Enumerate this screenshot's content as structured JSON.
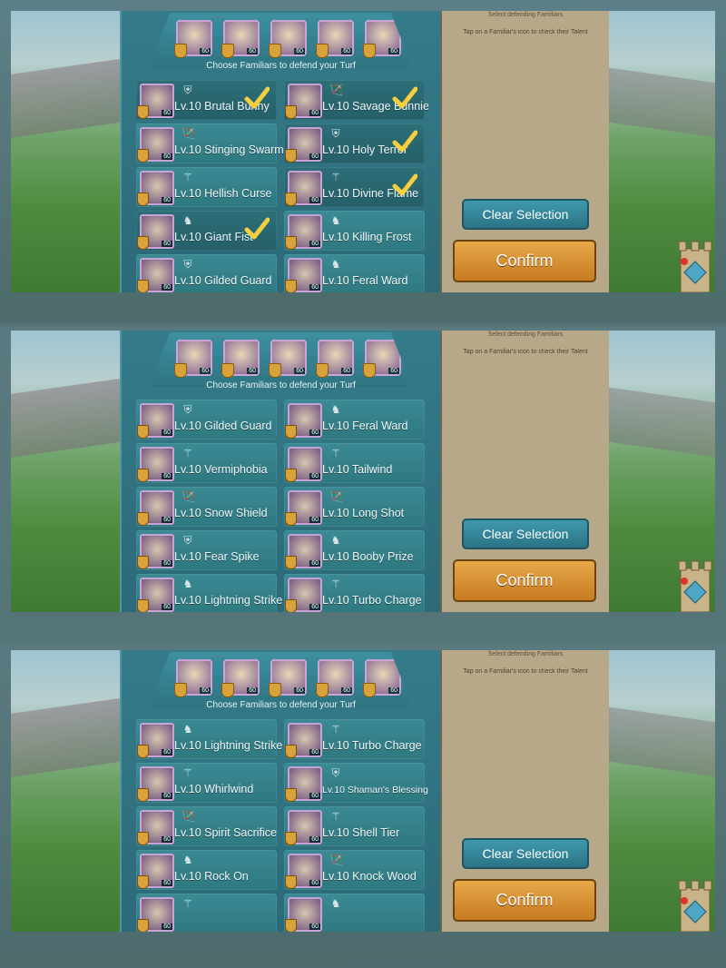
{
  "panels": [
    {
      "choose_text": "Choose Familiars to defend your Turf",
      "right_title": "Select defending Familiars",
      "right_hint": "Tap on a Familiar's icon to check their Talent",
      "clear_label": "Clear Selection",
      "confirm_label": "Confirm",
      "cells": [
        {
          "name": "Lv.10 Brutal Bunny",
          "icon": "shield",
          "selected": true
        },
        {
          "name": "Lv.10 Savage Bunnie",
          "icon": "bow",
          "selected": true
        },
        {
          "name": "Lv.10 Stinging Swarm",
          "icon": "bow",
          "selected": false
        },
        {
          "name": "Lv.10 Holy Terror",
          "icon": "shield",
          "selected": true
        },
        {
          "name": "Lv.10 Hellish Curse",
          "icon": "staff",
          "selected": false
        },
        {
          "name": "Lv.10 Divine Flame",
          "icon": "staff",
          "selected": true
        },
        {
          "name": "Lv.10 Giant Fist",
          "icon": "horse",
          "selected": true
        },
        {
          "name": "Lv.10 Killing Frost",
          "icon": "horse",
          "selected": false
        },
        {
          "name": "Lv.10 Gilded Guard",
          "icon": "shield",
          "selected": false
        },
        {
          "name": "Lv.10 Feral Ward",
          "icon": "horse",
          "selected": false
        }
      ]
    },
    {
      "choose_text": "Choose Familiars to defend your Turf",
      "right_title": "Select defending Familiars",
      "right_hint": "Tap on a Familiar's icon to check their Talent",
      "clear_label": "Clear Selection",
      "confirm_label": "Confirm",
      "cells": [
        {
          "name": "Lv.10 Gilded Guard",
          "icon": "shield",
          "selected": false
        },
        {
          "name": "Lv.10 Feral Ward",
          "icon": "horse",
          "selected": false
        },
        {
          "name": "Lv.10 Vermiphobia",
          "icon": "staff",
          "selected": false
        },
        {
          "name": "Lv.10 Tailwind",
          "icon": "staff",
          "selected": false
        },
        {
          "name": "Lv.10 Snow Shield",
          "icon": "bow",
          "selected": false
        },
        {
          "name": "Lv.10 Long Shot",
          "icon": "bow",
          "selected": false
        },
        {
          "name": "Lv.10 Fear Spike",
          "icon": "shield",
          "selected": false
        },
        {
          "name": "Lv.10 Booby Prize",
          "icon": "horse",
          "selected": false
        },
        {
          "name": "Lv.10 Lightning Strike",
          "icon": "horse",
          "selected": false
        },
        {
          "name": "Lv.10 Turbo Charge",
          "icon": "staff",
          "selected": false
        }
      ]
    },
    {
      "choose_text": "Choose Familiars to defend your Turf",
      "right_title": "Select defending Familiars",
      "right_hint": "Tap on a Familiar's icon to check their Talent",
      "clear_label": "Clear Selection",
      "confirm_label": "Confirm",
      "cells": [
        {
          "name": "Lv.10 Lightning Strike",
          "icon": "horse",
          "selected": false
        },
        {
          "name": "Lv.10 Turbo Charge",
          "icon": "staff",
          "selected": false
        },
        {
          "name": "Lv.10 Whirlwind",
          "icon": "staff",
          "selected": false
        },
        {
          "name": "Lv.10 Shaman's Blessing",
          "icon": "shield",
          "selected": false,
          "small": true
        },
        {
          "name": "Lv.10 Spirit Sacrifice",
          "icon": "bow",
          "selected": false
        },
        {
          "name": "Lv.10 Shell Tier",
          "icon": "staff",
          "selected": false
        },
        {
          "name": "Lv.10 Rock On",
          "icon": "horse",
          "selected": false
        },
        {
          "name": "Lv.10 Knock Wood",
          "icon": "bow",
          "selected": false
        },
        {
          "name": "",
          "icon": "staff",
          "selected": false
        },
        {
          "name": "",
          "icon": "horse",
          "selected": false
        }
      ]
    }
  ],
  "slot_level": "60",
  "icons": {
    "shield": "⛨",
    "bow": "🏹",
    "staff": "⚚",
    "horse": "♞"
  }
}
